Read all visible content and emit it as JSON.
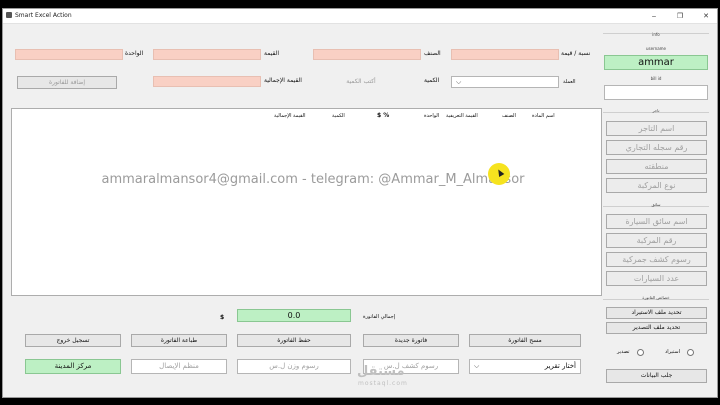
{
  "window": {
    "title": "Smart Excel Action",
    "minimize": "‒",
    "maximize": "❐",
    "close": "✕"
  },
  "form": {
    "unit_label": "الواحدة",
    "value_label": "القيمة",
    "category_label": "الصنف",
    "percent_label": "نسبة / قيمة",
    "total_label": "القيمة الإجمالية",
    "qty_label": "الكمية",
    "qty_placeholder": "أكتب الكمية",
    "currency_label": "العملة",
    "add_button": "إضافة للفاتورة"
  },
  "table": {
    "headers": [
      "اسم المادة",
      "الصنف",
      "القيمة التعريفية",
      "الواحدة",
      "$ %",
      "الكمية",
      "القيمة الإجمالية"
    ]
  },
  "watermark": "ammaralmansor4@gmail.com - telegram: @Ammar_M_Almansor",
  "totals": {
    "label": "إجمالي الفاتورة",
    "value": "0.0",
    "currency": "$"
  },
  "actions": {
    "clear": "مسح الفاتورة",
    "new": "فاتورة جديدة",
    "save": "حفظ الفاتورة",
    "print": "طباعة الفاتورة",
    "logout": "تسجيل خروج",
    "report": "أختار تقرير",
    "fee1": "رسوم كشف ل.س",
    "fee2": "رسوم وزن ل.س",
    "organizer": "منظم الإيصال",
    "city": "مركز المدينة"
  },
  "sidebar": {
    "info_label": "info",
    "username_label": "username",
    "username": "ammar",
    "bill_label": "bill id",
    "bill_id": "",
    "merchant_label": "تاجر",
    "merchant_fields": [
      "اسم التاجر",
      "رقم سجله التجاري",
      "منطقته",
      "نوع المركبة"
    ],
    "driver_label": "سائق",
    "driver_fields": [
      "اسم سائق السيارة",
      "رقم المركبة",
      "رسوم كشف جمركية",
      "عدد السيارات"
    ],
    "props_label": "خصائص الفاتورة",
    "import_button": "تحديد ملف الاستيراد",
    "export_button": "تحديد ملف التصدير",
    "radio_import": "استيراد",
    "radio_export": "تصدير",
    "fetch_button": "جلب البيانات"
  },
  "branding": {
    "logo": "مستقل",
    "logo_sub": "mostaql.com"
  }
}
